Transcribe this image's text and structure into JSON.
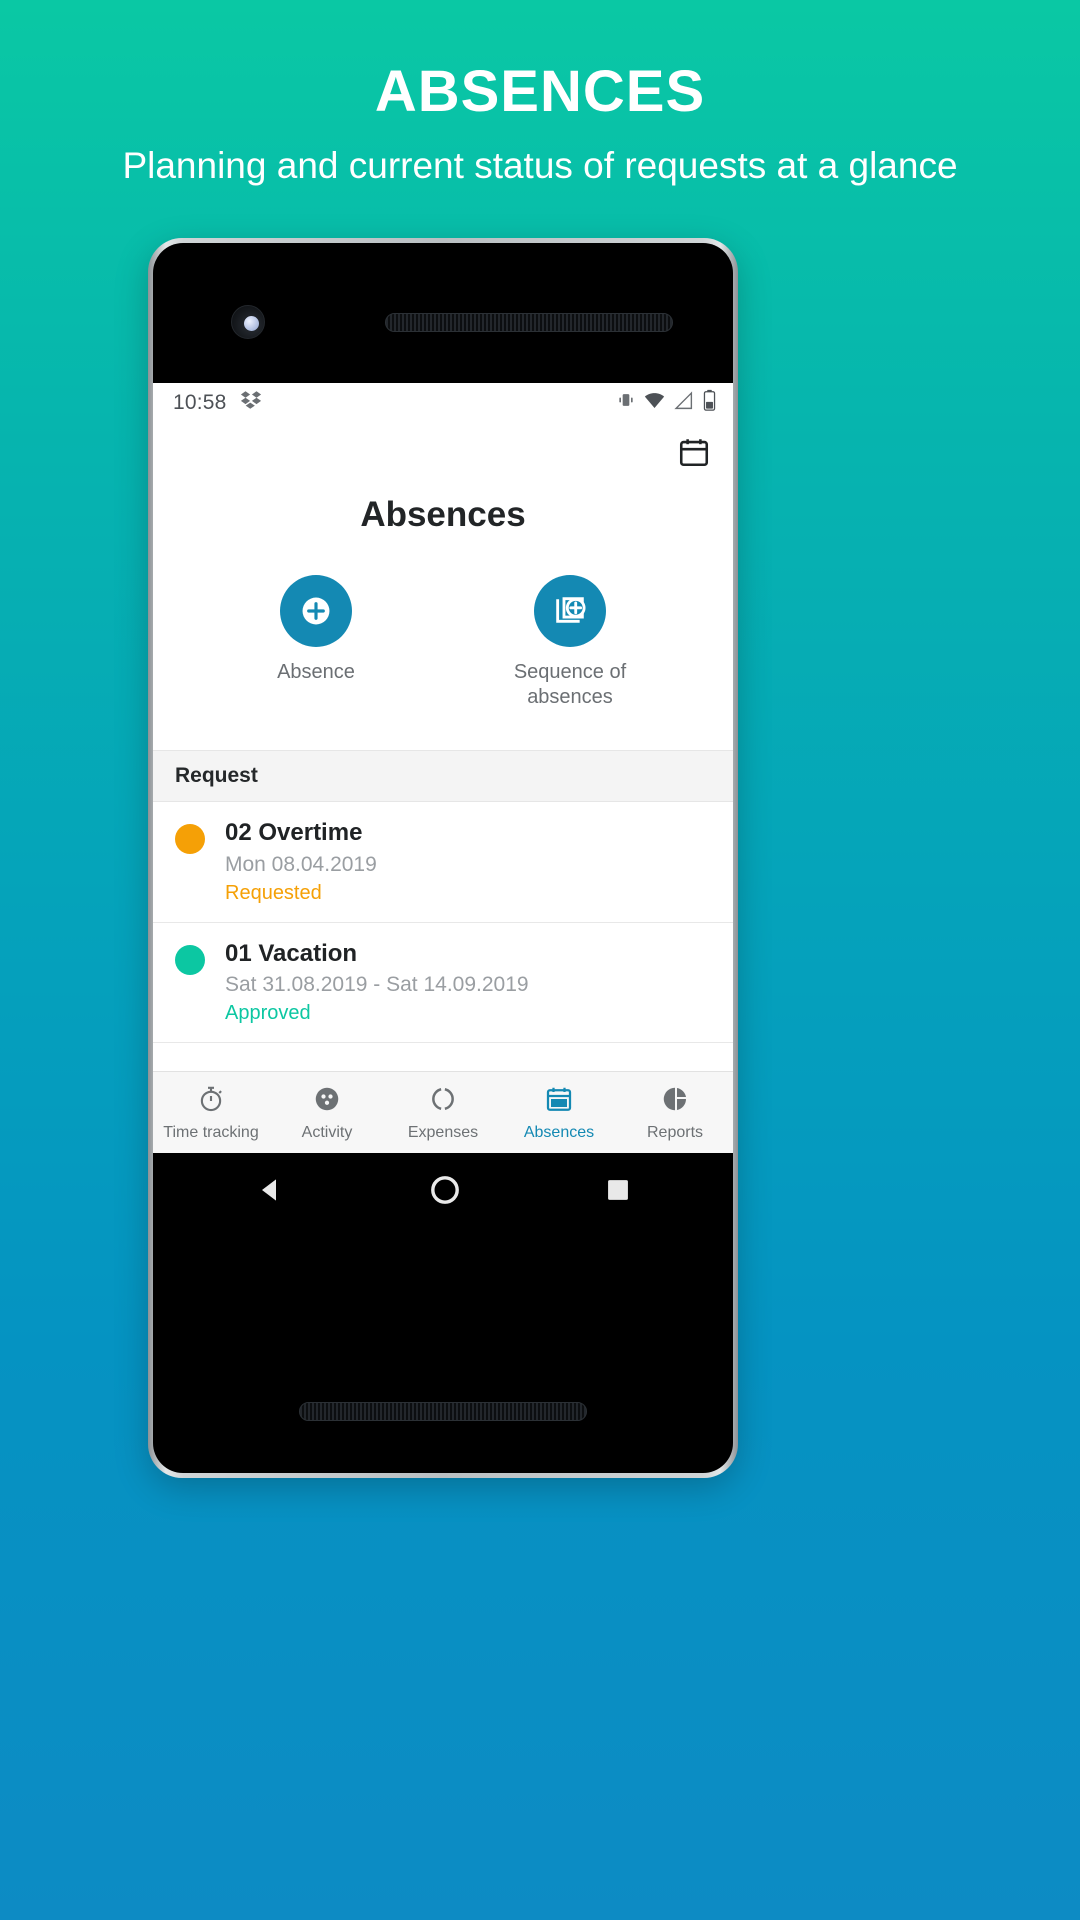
{
  "promo": {
    "title": "ABSENCES",
    "subtitle": "Planning and current status of requests at a glance",
    "background_top": "#0ac8a4",
    "background_bottom": "#0d8bc4"
  },
  "phone": {
    "camera_icon": "front-camera",
    "speaker_icon": "earpiece-speaker"
  },
  "statusbar": {
    "time": "10:58",
    "left_icons": [
      "dropbox-icon"
    ],
    "right_icons": [
      "vibrate-icon",
      "wifi-icon",
      "signal-icon",
      "battery-icon"
    ]
  },
  "appbar": {
    "calendar_action": "calendar-icon"
  },
  "screen": {
    "title": "Absences",
    "accent_color": "#1489b3"
  },
  "actions": [
    {
      "label": "Absence",
      "icon": "add-circle-icon"
    },
    {
      "label": "Sequence of absences",
      "icon": "add-sequence-icon"
    }
  ],
  "request_section": {
    "header": "Request",
    "items": [
      {
        "dot_color": "#f5a006",
        "title": "02 Overtime",
        "date": "Mon 08.04.2019",
        "status": "Requested",
        "status_color": "#f5a006"
      },
      {
        "dot_color": "#0cc7a2",
        "title": "01 Vacation",
        "date": "Sat 31.08.2019 - Sat 14.09.2019",
        "status": "Approved",
        "status_color": "#0cc7a2"
      }
    ]
  },
  "bottom_nav": {
    "active_index": 3,
    "items": [
      {
        "label": "Time tracking",
        "icon": "stopwatch-icon"
      },
      {
        "label": "Activity",
        "icon": "activity-icon"
      },
      {
        "label": "Expenses",
        "icon": "expenses-icon"
      },
      {
        "label": "Absences",
        "icon": "calendar-icon"
      },
      {
        "label": "Reports",
        "icon": "pie-chart-icon"
      }
    ]
  },
  "android_nav": {
    "items": [
      "back-button",
      "home-button",
      "recents-button"
    ]
  }
}
